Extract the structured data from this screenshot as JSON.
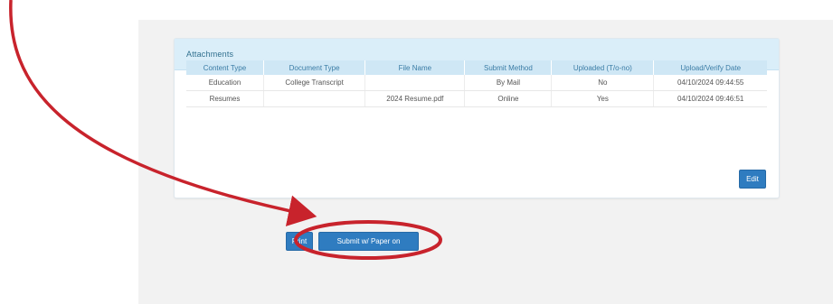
{
  "panel": {
    "title": "Attachments"
  },
  "table": {
    "headers": [
      "Content Type",
      "Document Type",
      "File Name",
      "Submit Method",
      "Uploaded (T/o-no)",
      "Upload/Verify Date"
    ],
    "rows": [
      [
        "Education",
        "College Transcript",
        "",
        "By Mail",
        "No",
        "04/10/2024 09:44:55"
      ],
      [
        "Resumes",
        "",
        "2024 Resume.pdf",
        "Online",
        "Yes",
        "04/10/2024 09:46:51"
      ]
    ]
  },
  "buttons": {
    "edit": "Edit",
    "print": "Print",
    "submit": "Submit w/ Paper on"
  },
  "colors": {
    "annotation_red": "#c8232c",
    "button_blue": "#2f7cc0",
    "header_bg": "#daeef9"
  }
}
